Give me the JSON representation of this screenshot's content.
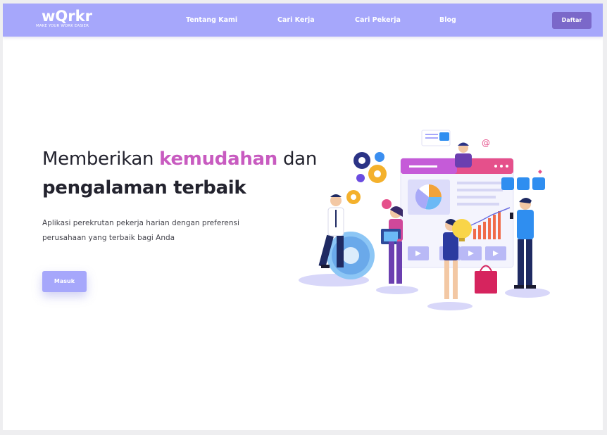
{
  "brand": {
    "name": "wQrkr",
    "tagline": "MAKE YOUR WORK EASIER"
  },
  "nav": {
    "items": [
      {
        "label": "Tentang Kami"
      },
      {
        "label": "Cari Kerja"
      },
      {
        "label": "Cari Pekerja"
      },
      {
        "label": "Blog"
      }
    ],
    "signup_label": "Daftar"
  },
  "hero": {
    "line1_pre": "Memberikan ",
    "line1_highlight": "kemudahan",
    "line1_post": " dan",
    "line2": "pengalaman terbaik",
    "description": "Aplikasi perekrutan pekerja harian dengan preferensi perusahaan yang terbaik bagi Anda",
    "login_label": "Masuk"
  },
  "colors": {
    "nav_bg": "#a6a7fb",
    "accent": "#c85bc0",
    "signup_bg": "#7b68c9"
  }
}
